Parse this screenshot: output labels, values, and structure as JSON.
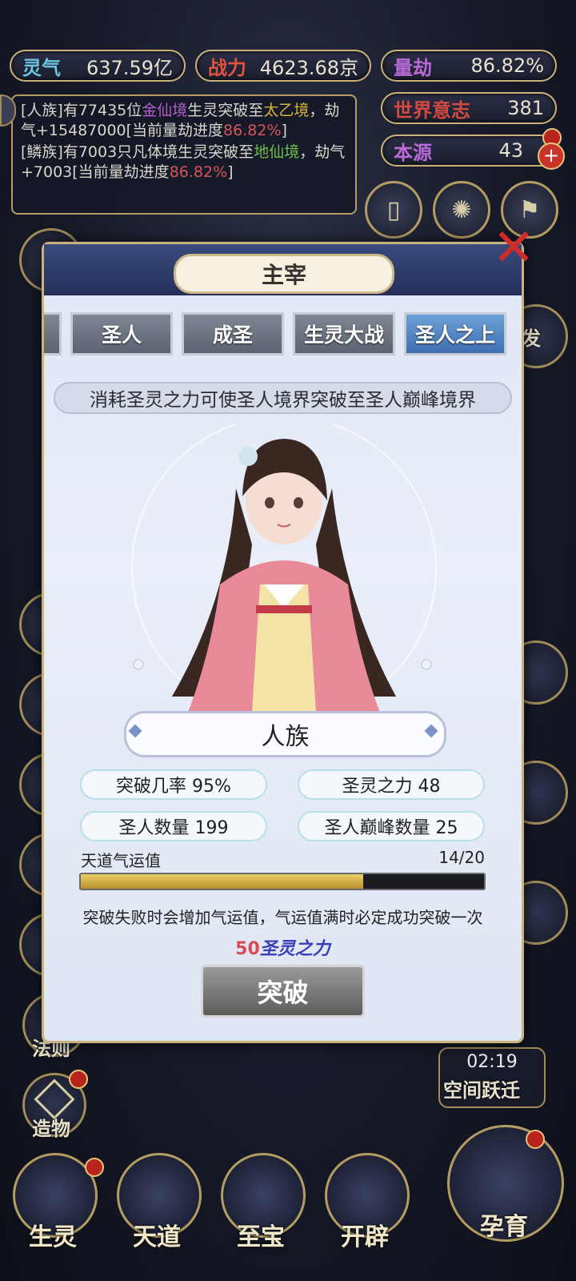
{
  "resources": {
    "lingqi": {
      "label": "灵气",
      "value": "637.59亿"
    },
    "zhanli": {
      "label": "战力",
      "value": "4623.68京"
    },
    "liangjie": {
      "label": "量劫",
      "value": "86.82%"
    },
    "shijie": {
      "label": "世界意志",
      "value": "381"
    },
    "benyuan": {
      "label": "本源",
      "value": "43"
    }
  },
  "log": {
    "line1_prefix": "[人族]有77435位",
    "line1_realm1": "金仙境",
    "line1_mid": "生灵突破至",
    "line1_realm2": "太乙境",
    "line1_suffix": "，劫气+15487000[当前量劫进度",
    "line1_percent": "86.82%",
    "line1_end": "]",
    "line2_prefix": "[鳞族]有7003只凡体境生灵突破至",
    "line2_realm": "地仙境",
    "line2_suffix": "，劫气+7003[当前量劫进度",
    "line2_percent": "86.82%",
    "line2_end": "]"
  },
  "side_left": [
    {
      "label": "法则"
    },
    {
      "label": "造物"
    }
  ],
  "side_right": {
    "timer": "02:19",
    "space_jump": "空间跃迁",
    "partial_label": "发"
  },
  "modal": {
    "title": "主宰",
    "tabs": [
      "圣人",
      "成圣",
      "生灵大战",
      "圣人之上"
    ],
    "active_tab": "圣人之上",
    "description": "消耗圣灵之力可使圣人境界突破至圣人巅峰境界",
    "race": "人族",
    "stats": {
      "chance": "突破几率 95%",
      "power": "圣灵之力 48",
      "saints": "圣人数量 199",
      "peak_saints": "圣人巅峰数量 25"
    },
    "fortune": {
      "label": "天道气运值",
      "value": "14/20",
      "fraction": 0.7
    },
    "note": "突破失败时会增加气运值，气运值满时必定成功突破一次",
    "cost_num": "50",
    "cost_unit": "圣灵之力",
    "break_button": "突破"
  },
  "bottom_nav": [
    "生灵",
    "天道",
    "至宝",
    "开辟",
    "孕育"
  ]
}
